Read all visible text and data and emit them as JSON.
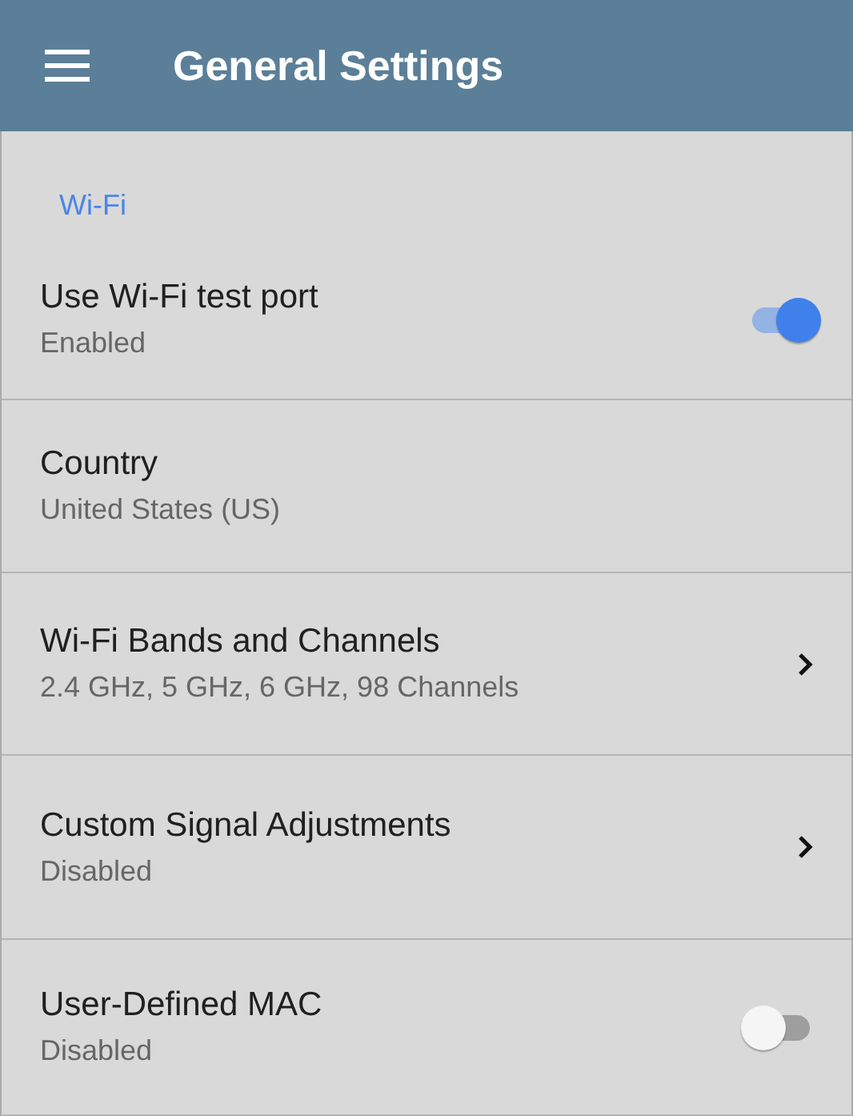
{
  "app_bar": {
    "title": "General Settings"
  },
  "section": {
    "title": "Wi-Fi"
  },
  "items": [
    {
      "kind": "toggle",
      "title": "Use Wi-Fi test port",
      "summary": "Enabled",
      "on": true
    },
    {
      "kind": "plain",
      "title": "Country",
      "summary": "United States (US)"
    },
    {
      "kind": "nav",
      "title": "Wi-Fi Bands and Channels",
      "summary": "2.4 GHz, 5 GHz, 6 GHz, 98 Channels"
    },
    {
      "kind": "nav",
      "title": "Custom Signal Adjustments",
      "summary": "Disabled"
    },
    {
      "kind": "toggle",
      "title": "User-Defined MAC",
      "summary": "Disabled",
      "on": false
    }
  ]
}
